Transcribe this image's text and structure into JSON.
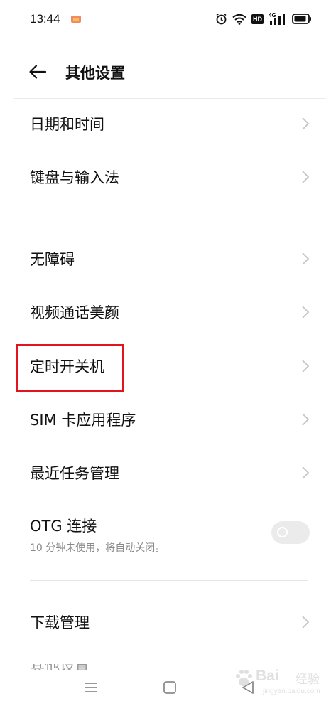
{
  "status_bar": {
    "time": "13:44",
    "network_type": "4G",
    "hd_label": "HD",
    "icons": [
      "notification-icon",
      "alarm-icon",
      "wifi-icon",
      "hd-icon",
      "signal-icon",
      "battery-icon"
    ]
  },
  "header": {
    "title": "其他设置",
    "back_icon": "arrow-left-icon"
  },
  "groups": [
    {
      "items": [
        {
          "label": "日期和时间"
        },
        {
          "label": "键盘与输入法"
        }
      ]
    },
    {
      "items": [
        {
          "label": "无障碍"
        },
        {
          "label": "视频通话美颜"
        },
        {
          "label": "定时开关机",
          "highlighted": true
        },
        {
          "label": "SIM 卡应用程序"
        },
        {
          "label": "最近任务管理"
        }
      ]
    }
  ],
  "otg": {
    "label": "OTG 连接",
    "description": "10 分钟未使用，将自动关闭。",
    "enabled": false
  },
  "download": {
    "label": "下载管理"
  },
  "partial_item": {
    "label": "其他设置"
  },
  "highlight_color": "#e3141e",
  "nav_bar": {
    "buttons": [
      "menu-icon",
      "home-icon",
      "back-triangle-icon"
    ]
  },
  "watermark": {
    "brand": "Bai",
    "brand_cn": "经验",
    "url": "jingyan.baidu.com"
  }
}
